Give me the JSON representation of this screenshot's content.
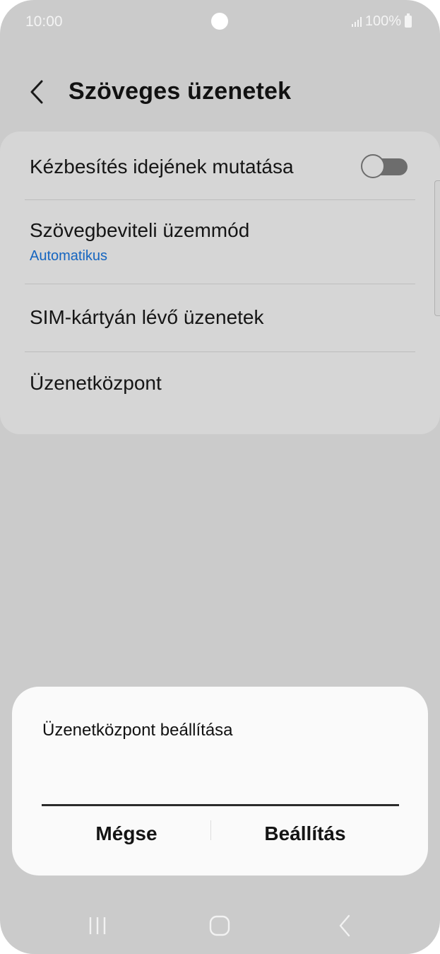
{
  "status_bar": {
    "time": "10:00",
    "battery": "100%"
  },
  "header": {
    "title": "Szöveges üzenetek"
  },
  "settings": {
    "show_delivery_time": {
      "label": "Kézbesítés idejének mutatása",
      "enabled": false
    },
    "input_mode": {
      "label": "Szövegbeviteli üzemmód",
      "value": "Automatikus"
    },
    "sim_messages": {
      "label": "SIM-kártyán lévő üzenetek"
    },
    "message_center": {
      "label": "Üzenetközpont"
    }
  },
  "dialog": {
    "title": "Üzenetközpont beállítása",
    "input_value": "",
    "cancel_label": "Mégse",
    "confirm_label": "Beállítás"
  },
  "colors": {
    "accent": "#1565c0",
    "background": "#cbcbcb",
    "card": "#d6d6d6",
    "dialog": "#fafafa"
  },
  "icons": {
    "back": "chevron-left-icon",
    "signal": "signal-icon",
    "battery": "battery-icon",
    "recents": "recents-icon",
    "home": "home-icon",
    "nav_back": "back-icon"
  }
}
